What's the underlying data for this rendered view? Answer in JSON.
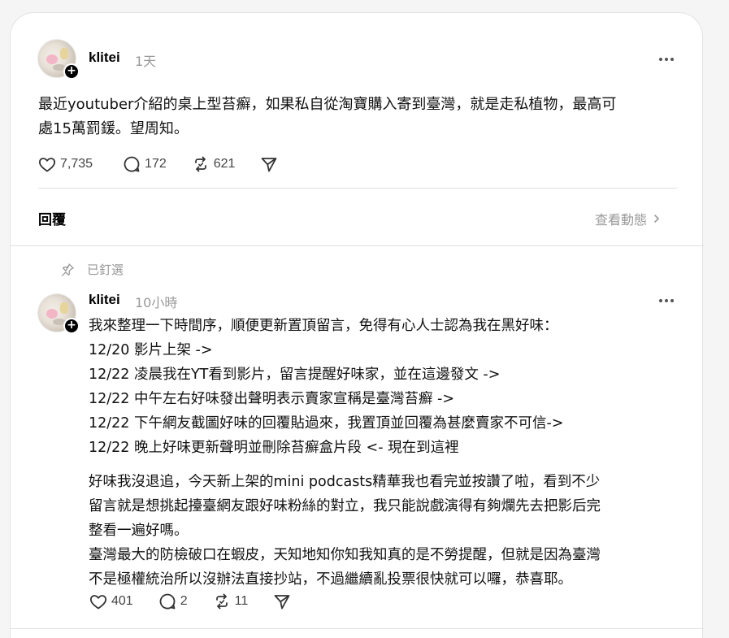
{
  "main_post": {
    "username": "klitei",
    "timestamp": "1天",
    "text_line1": "最近youtuber介紹的桌上型苔癬，如果私自從淘寶購入寄到臺灣，就是走私植物，最高可",
    "text_line2": "處15萬罰鍰。望周知。",
    "likes": "7,735",
    "replies": "172",
    "reposts": "621"
  },
  "reply_header": {
    "label": "回覆",
    "view_activity": "查看動態"
  },
  "pinned_reply": {
    "pinned_label": "已釘選",
    "username": "klitei",
    "timestamp": "10小時",
    "lines": [
      "我來整理一下時間序，順便更新置頂留言，免得有心人士認為我在黑好味：",
      "12/20 影片上架 ->",
      "12/22 凌晨我在YT看到影片，留言提醒好味家，並在這邊發文 ->",
      "12/22 中午左右好味發出聲明表示賣家宣稱是臺灣苔癬 ->",
      "12/22 下午網友截圖好味的回覆貼過來，我置頂並回覆為甚麼賣家不可信->",
      "12/22 晚上好味更新聲明並刪除苔癬盒片段 <- 現在到這裡"
    ],
    "paragraph2": [
      "好味我沒退追，今天新上架的mini podcasts精華我也看完並按讚了啦，看到不少",
      "留言就是想挑起擡臺網友跟好味粉絲的對立，我只能說戲演得有夠爛先去把影后完",
      "整看一遍好嗎。",
      "臺灣最大的防檢破口在蝦皮，天知地知你知我知真的是不勞提醒，但就是因為臺灣",
      "不是極權統治所以沒辦法直接抄站，不過繼續亂投票很快就可以囉，恭喜耶。"
    ],
    "likes": "401",
    "replies": "2",
    "reposts": "11"
  }
}
